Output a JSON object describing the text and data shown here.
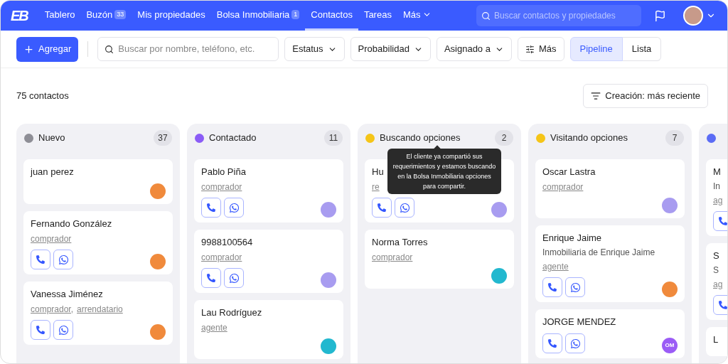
{
  "nav": {
    "logo": "EB",
    "items": [
      {
        "label": "Tablero",
        "selected": false
      },
      {
        "label": "Buzón",
        "badge": "33",
        "selected": false
      },
      {
        "label": "Mis propiedades",
        "selected": false
      },
      {
        "label": "Bolsa Inmobiliaria",
        "badge": "1",
        "selected": false
      },
      {
        "label": "Contactos",
        "selected": true
      },
      {
        "label": "Tareas",
        "selected": false
      },
      {
        "label": "Más",
        "menu": true,
        "selected": false
      }
    ],
    "search": {
      "placeholder": "Buscar contactos y propiedades"
    }
  },
  "toolbar": {
    "add_button": "Agregar",
    "search": {
      "placeholder": "Buscar por nombre, teléfono, etc."
    },
    "filters": [
      "Estatus",
      "Probabilidad",
      "Asignado a"
    ],
    "more_button": "Más",
    "views": [
      {
        "label": "Pipeline",
        "selected": true
      },
      {
        "label": "Lista",
        "selected": false
      }
    ]
  },
  "summary": {
    "count": "75 contactos",
    "sort_button": "Creación: más reciente"
  },
  "columns": [
    {
      "title": "Nuevo",
      "color": "#8e8e96",
      "count": "37",
      "cards": [
        {
          "name": "juan perez",
          "actions": false,
          "avatar": {
            "kind": "photo",
            "color": "#f08a3c"
          }
        },
        {
          "name": "Fernando González",
          "tags": [
            "comprador"
          ],
          "actions": true,
          "avatar": {
            "kind": "photo",
            "color": "#f08a3c"
          }
        },
        {
          "name": "Vanessa Jiménez",
          "tags": [
            "comprador,",
            "arrendatario"
          ],
          "actions": true,
          "avatar": {
            "kind": "photo",
            "color": "#f08a3c"
          }
        }
      ]
    },
    {
      "title": "Contactado",
      "color": "#8b5cf6",
      "count": "11",
      "cards": [
        {
          "name": "Pablo Piña",
          "tags": [
            "comprador"
          ],
          "actions": true,
          "avatar": {
            "kind": "photo",
            "color": "#a89cf0"
          }
        },
        {
          "name": "9988100564",
          "tags": [
            "comprador"
          ],
          "actions": true,
          "avatar": {
            "kind": "photo",
            "color": "#a89cf0"
          }
        },
        {
          "name": "Lau Rodríguez",
          "tags": [
            "agente"
          ],
          "actions": false,
          "avatar": {
            "kind": "photo",
            "color": "#22b8cf"
          }
        }
      ]
    },
    {
      "title": "Buscando opciones",
      "color": "#f5c518",
      "count": "2",
      "tooltip": "El cliente ya compartió sus requerimientos y estamos buscando en la Bolsa Inmobiliaria opciones para compartir.",
      "cards": [
        {
          "name": "Hu",
          "tags": [
            "re"
          ],
          "actions": true,
          "avatar": {
            "kind": "photo",
            "color": "#a89cf0"
          }
        },
        {
          "name": "Norma Torres",
          "tags": [
            "comprador"
          ],
          "actions": false,
          "avatar": {
            "kind": "photo",
            "color": "#22b8cf"
          }
        }
      ]
    },
    {
      "title": "Visitando opciones",
      "color": "#f5c518",
      "count": "7",
      "cards": [
        {
          "name": "Oscar Lastra",
          "tags": [
            "comprador"
          ],
          "actions": false,
          "avatar": {
            "kind": "photo",
            "color": "#a89cf0"
          }
        },
        {
          "name": "Enrique Jaime",
          "subtitle": "Inmobiliaria de Enrique Jaime",
          "tags": [
            "agente"
          ],
          "actions": true,
          "avatar": {
            "kind": "photo",
            "color": "#f08a3c"
          }
        },
        {
          "name": "JORGE MENDEZ",
          "actions": true,
          "avatar": {
            "kind": "initials",
            "color": "#9b5cf6",
            "text": "OM"
          }
        }
      ]
    },
    {
      "color": "#5b6cf5",
      "cards": [
        {
          "name": "M",
          "subtitle": "In",
          "tags": [
            "ag"
          ],
          "actions": true
        },
        {
          "name": "S",
          "subtitle": "S",
          "tags": [
            "ag"
          ],
          "actions": true
        },
        {
          "name": "L",
          "actions": false
        }
      ]
    }
  ]
}
